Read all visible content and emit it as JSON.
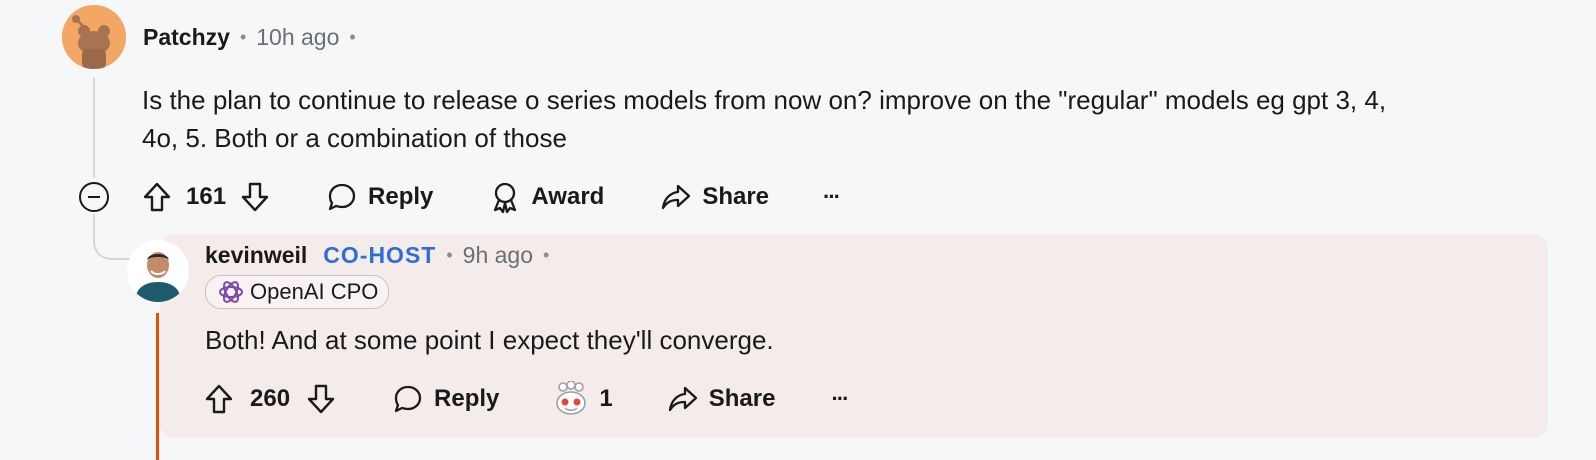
{
  "comment": {
    "author": "Patchzy",
    "time": "10h ago",
    "text": "Is the plan to continue to release o series models from now on? improve on the \"regular\" models eg gpt 3, 4, 4o, 5. Both or a combination of those",
    "text_line1": "Is the plan to continue to release o series models from now on? improve on the \"regular\" models eg gpt 3, 4,",
    "text_line2": "4o, 5. Both or a combination of those",
    "score": "161",
    "actions": {
      "reply": "Reply",
      "award": "Award",
      "share": "Share",
      "more": "···"
    }
  },
  "reply": {
    "author": "kevinweil",
    "badge": "CO-HOST",
    "time": "9h ago",
    "flair": "OpenAI CPO",
    "text": "Both! And at some point I expect they'll converge.",
    "score": "260",
    "award_count": "1",
    "actions": {
      "reply": "Reply",
      "share": "Share",
      "more": "···"
    }
  },
  "colors": {
    "background": "#f6f7f9",
    "reply_card": "#f4ecea",
    "cohost": "#2f6fd3",
    "thread_accent": "#f04a00",
    "avatar_orange": "#f2a765"
  },
  "icons": [
    "collapse-icon",
    "upvote-icon",
    "downvote-icon",
    "reply-icon",
    "award-icon",
    "share-icon",
    "more-icon",
    "openai-icon",
    "award-snoo-icon"
  ]
}
